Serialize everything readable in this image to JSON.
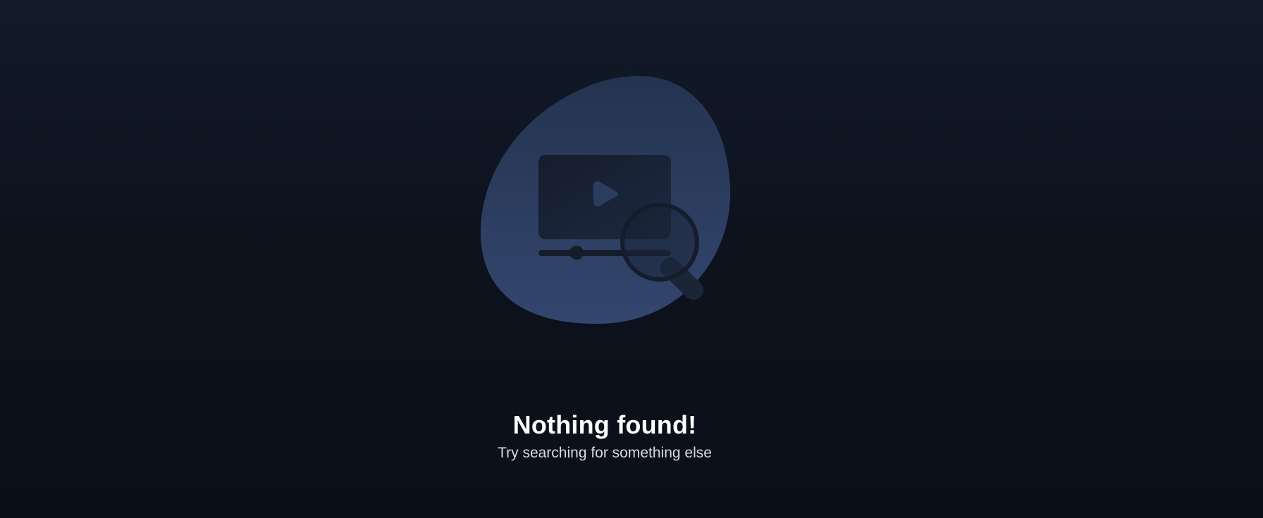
{
  "empty_state": {
    "title": "Nothing found!",
    "subtitle": "Try searching for something else",
    "illustration_icon": "video-search-icon"
  },
  "colors": {
    "background_top": "#121a2a",
    "background_bottom": "#0b0f18",
    "blob_top": "#24334f",
    "blob_bottom": "#33466e",
    "title": "#ffffff",
    "subtitle": "#d5dae3"
  }
}
